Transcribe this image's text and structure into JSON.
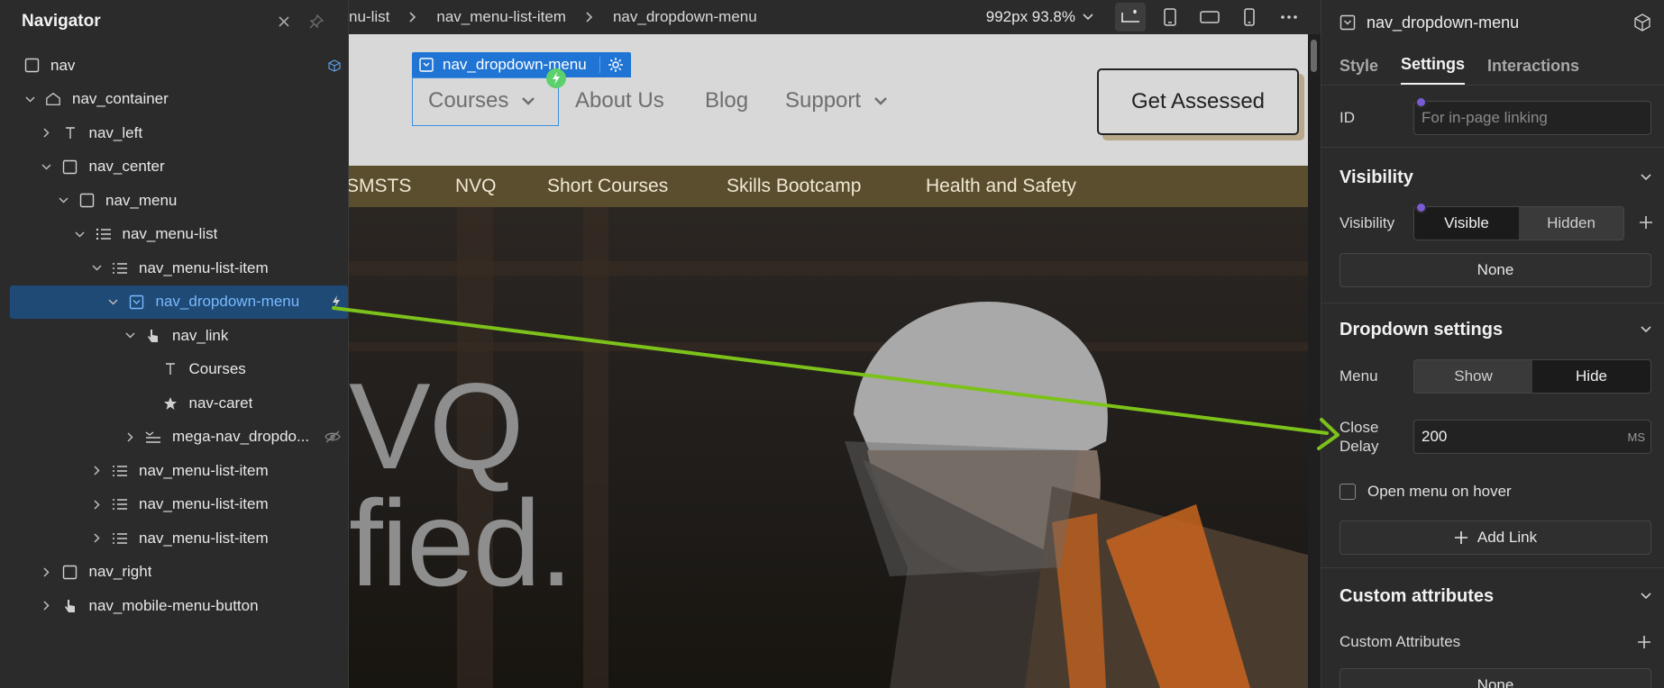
{
  "navigator": {
    "title": "Navigator",
    "tree": [
      {
        "label": "nav",
        "icon": "box-icon",
        "depth": 0,
        "caret": "none",
        "end_icon": "component-cube-icon"
      },
      {
        "label": "nav_container",
        "icon": "home-icon",
        "depth": 0,
        "caret": "down"
      },
      {
        "label": "nav_left",
        "icon": "text-icon",
        "depth": 1,
        "caret": "right"
      },
      {
        "label": "nav_center",
        "icon": "box-icon",
        "depth": 1,
        "caret": "down"
      },
      {
        "label": "nav_menu",
        "icon": "box-icon",
        "depth": 2,
        "caret": "down"
      },
      {
        "label": "nav_menu-list",
        "icon": "list-icon",
        "depth": 3,
        "caret": "down"
      },
      {
        "label": "nav_menu-list-item",
        "icon": "list-item-icon",
        "depth": 4,
        "caret": "down"
      },
      {
        "label": "nav_dropdown-menu",
        "icon": "dropdown-icon",
        "depth": 5,
        "caret": "down",
        "selected": true,
        "end_icon": "bolt-icon"
      },
      {
        "label": "nav_link",
        "icon": "pointer-icon",
        "depth": 6,
        "caret": "down"
      },
      {
        "label": "Courses",
        "icon": "text-icon",
        "depth": 7,
        "caret": "none"
      },
      {
        "label": "nav-caret",
        "icon": "star-icon",
        "depth": 7,
        "caret": "none"
      },
      {
        "label": "mega-nav_dropdo...",
        "icon": "dropdown-list-icon",
        "depth": 6,
        "caret": "right",
        "end_icon": "eye-slash-icon"
      },
      {
        "label": "nav_menu-list-item",
        "icon": "list-item-icon",
        "depth": 4,
        "caret": "right"
      },
      {
        "label": "nav_menu-list-item",
        "icon": "list-item-icon",
        "depth": 4,
        "caret": "right"
      },
      {
        "label": "nav_menu-list-item",
        "icon": "list-item-icon",
        "depth": 4,
        "caret": "right"
      },
      {
        "label": "nav_right",
        "icon": "box-icon",
        "depth": 1,
        "caret": "right"
      },
      {
        "label": "nav_mobile-menu-button",
        "icon": "pointer-icon",
        "depth": 1,
        "caret": "right"
      }
    ]
  },
  "toolbar": {
    "breadcrumbs": [
      "nu-list",
      "nav_menu-list-item",
      "nav_dropdown-menu"
    ],
    "viewport": "992px 93.8%"
  },
  "canvas": {
    "selected_tag": "nav_dropdown-menu",
    "nav_links": [
      "Courses",
      "About Us",
      "Blog",
      "Support"
    ],
    "cta": "Get Assessed",
    "sub_nav": [
      "SMSTS",
      "NVQ",
      "Short Courses",
      "Skills Bootcamp",
      "Health and Safety"
    ],
    "hero_line1": "VQ",
    "hero_line2": "fied."
  },
  "panel": {
    "element_name": "nav_dropdown-menu",
    "tabs": [
      "Style",
      "Settings",
      "Interactions"
    ],
    "active_tab": "Settings",
    "id_label": "ID",
    "id_placeholder": "For in-page linking",
    "visibility_section": "Visibility",
    "visibility_label": "Visibility",
    "visibility_options": [
      "Visible",
      "Hidden"
    ],
    "visibility_selected": "Visible",
    "condition_value": "None",
    "dropdown_section": "Dropdown settings",
    "menu_label": "Menu",
    "menu_options": [
      "Show",
      "Hide"
    ],
    "menu_selected": "Hide",
    "close_delay_label": "Close Delay",
    "close_delay_value": "200",
    "close_delay_unit": "MS",
    "hover_label": "Open menu on hover",
    "add_link": "Add Link",
    "custom_section": "Custom attributes",
    "custom_label": "Custom Attributes",
    "custom_value": "None"
  },
  "colors": {
    "accent_blue": "#1f74d4",
    "arrow_green": "#7cc21a",
    "selected_row": "#1f4a75"
  }
}
